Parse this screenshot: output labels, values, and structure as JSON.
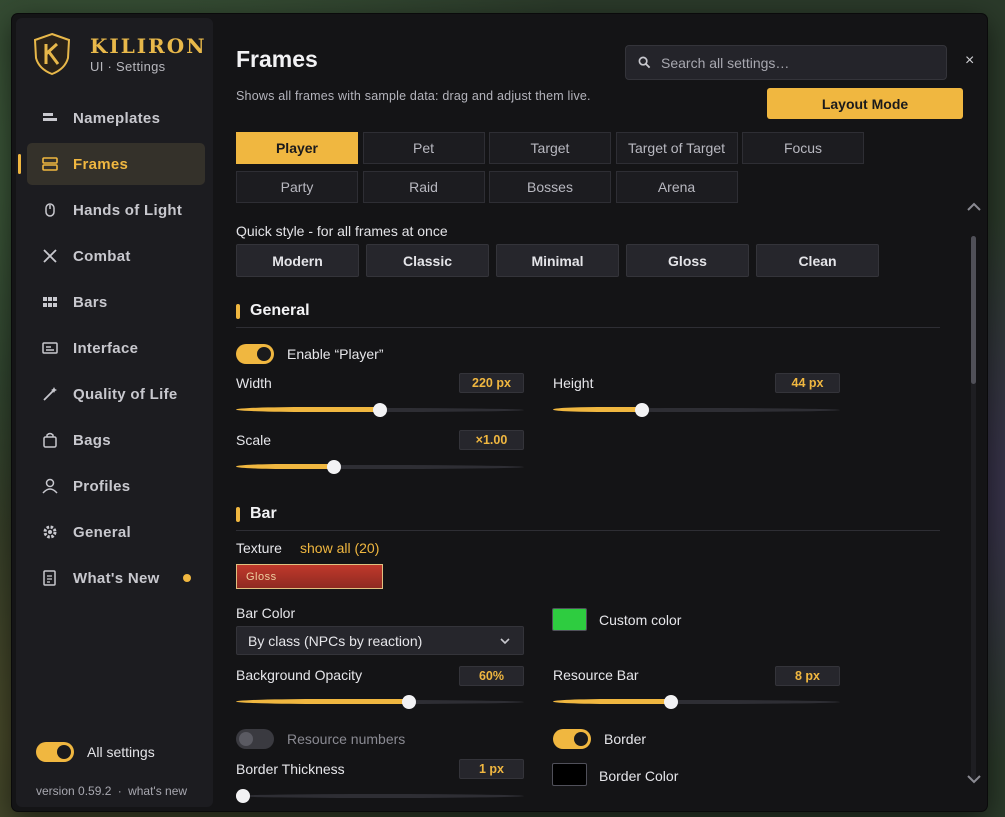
{
  "brand": {
    "name": "KILIRON",
    "subtitle": "UI · Settings"
  },
  "sidebar": {
    "items": [
      {
        "label": "Nameplates",
        "icon": "nameplates-icon"
      },
      {
        "label": "Frames",
        "icon": "frames-icon",
        "active": true
      },
      {
        "label": "Hands of Light",
        "icon": "mouse-icon"
      },
      {
        "label": "Combat",
        "icon": "crossed-swords-icon"
      },
      {
        "label": "Bars",
        "icon": "grid-icon"
      },
      {
        "label": "Interface",
        "icon": "interface-icon"
      },
      {
        "label": "Quality of Life",
        "icon": "magic-wand-icon"
      },
      {
        "label": "Bags",
        "icon": "bag-icon"
      },
      {
        "label": "Profiles",
        "icon": "user-icon"
      },
      {
        "label": "General",
        "icon": "gear-icon"
      },
      {
        "label": "What's New",
        "icon": "document-icon",
        "badge": true
      }
    ],
    "all_settings_label": "All settings",
    "all_settings_on": true,
    "version": "version 0.59.2",
    "separator": "·",
    "whats_new_link": "what's new"
  },
  "header": {
    "title": "Frames",
    "subtitle": "Shows all frames with sample data: drag and adjust them live.",
    "search_placeholder": "Search all settings…",
    "close_label": "×",
    "layout_mode_label": "Layout Mode"
  },
  "tabs": [
    "Player",
    "Pet",
    "Target",
    "Target of Target",
    "Focus",
    "Party",
    "Raid",
    "Bosses",
    "Arena"
  ],
  "active_tab": "Player",
  "quick_style": {
    "label": "Quick style - for all frames at once",
    "options": [
      "Modern",
      "Classic",
      "Minimal",
      "Gloss",
      "Clean"
    ]
  },
  "general": {
    "heading": "General",
    "enable_label": "Enable “Player”",
    "enable_on": true,
    "width": {
      "label": "Width",
      "value": "220 px",
      "fraction": 0.5
    },
    "height": {
      "label": "Height",
      "value": "44 px",
      "fraction": 0.31
    },
    "scale": {
      "label": "Scale",
      "value": "×1.00",
      "fraction": 0.34
    }
  },
  "bar": {
    "heading": "Bar",
    "texture_label": "Texture",
    "texture_link": "show all (20)",
    "texture_value": "Gloss",
    "bar_color_label": "Bar Color",
    "bar_color_value": "By class (NPCs by reaction)",
    "custom_color_label": "Custom color",
    "custom_color": "#2ecc40",
    "bg_opacity": {
      "label": "Background Opacity",
      "value": "60%",
      "fraction": 0.6
    },
    "resource_bar": {
      "label": "Resource Bar",
      "value": "8 px",
      "fraction": 0.41
    },
    "resource_numbers_label": "Resource numbers",
    "resource_numbers_on": false,
    "border_label": "Border",
    "border_on": true,
    "border_thickness": {
      "label": "Border Thickness",
      "value": "1 px",
      "fraction": 0.0
    },
    "border_color_label": "Border Color",
    "border_color": "#000000"
  },
  "colors": {
    "accent": "#f0b740",
    "panel": "#141416",
    "sidebar": "#1c1c20"
  }
}
